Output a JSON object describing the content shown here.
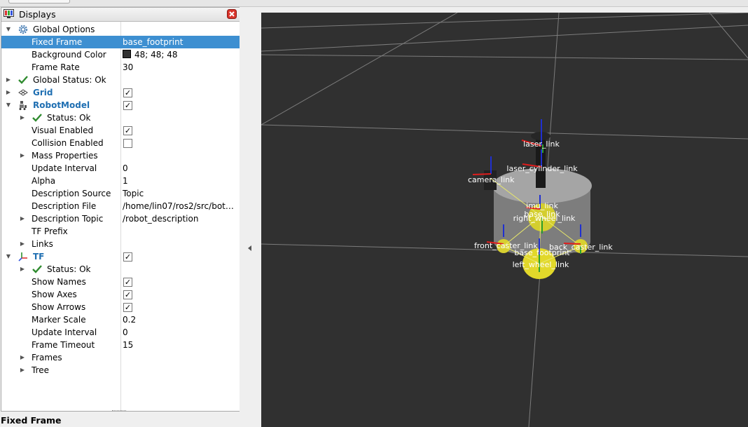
{
  "panel": {
    "title": "Displays"
  },
  "rows": [
    {
      "label": "Global Options"
    },
    {
      "label": "Fixed Frame",
      "value": "base_footprint"
    },
    {
      "label": "Background Color",
      "value": "48; 48; 48"
    },
    {
      "label": "Frame Rate",
      "value": "30"
    },
    {
      "label": "Global Status: Ok"
    },
    {
      "label": "Grid",
      "checked": true
    },
    {
      "label": "RobotModel",
      "checked": true
    },
    {
      "label": "Status: Ok"
    },
    {
      "label": "Visual Enabled",
      "checked": true
    },
    {
      "label": "Collision Enabled",
      "checked": false
    },
    {
      "label": "Mass Properties"
    },
    {
      "label": "Update Interval",
      "value": "0"
    },
    {
      "label": "Alpha",
      "value": "1"
    },
    {
      "label": "Description Source",
      "value": "Topic"
    },
    {
      "label": "Description File",
      "value": "/home/lin07/ros2/src/bot…"
    },
    {
      "label": "Description Topic",
      "value": "/robot_description"
    },
    {
      "label": "TF Prefix",
      "value": ""
    },
    {
      "label": "Links"
    },
    {
      "label": "TF",
      "checked": true
    },
    {
      "label": "Status: Ok"
    },
    {
      "label": "Show Names",
      "checked": true
    },
    {
      "label": "Show Axes",
      "checked": true
    },
    {
      "label": "Show Arrows",
      "checked": true
    },
    {
      "label": "Marker Scale",
      "value": "0.2"
    },
    {
      "label": "Update Interval",
      "value": "0"
    },
    {
      "label": "Frame Timeout",
      "value": "15"
    },
    {
      "label": "Frames"
    },
    {
      "label": "Tree"
    }
  ],
  "status": {
    "title": "Fixed Frame"
  },
  "viewport": {
    "background_color": "#303030",
    "frame_labels": {
      "laser": "laser_link",
      "laser_cyl": "laser_cylinder_link",
      "camera": "camera_link",
      "imu": "imu_link",
      "base": "base_link",
      "right_wheel": "right_wheel_link",
      "front_caster": "front_caster_link",
      "base_footprint": "base_footprint",
      "back_caster": "back_caster_link",
      "left_wheel": "left_wheel_link"
    }
  }
}
